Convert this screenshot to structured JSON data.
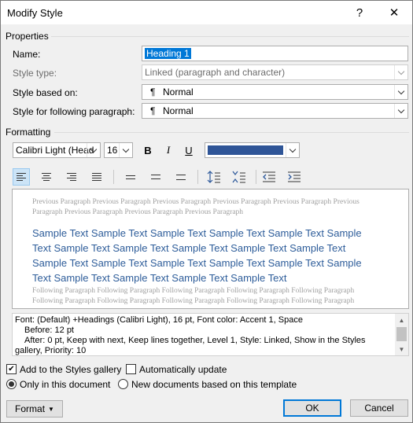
{
  "window": {
    "title": "Modify Style",
    "help_label": "?",
    "close_label": "✕"
  },
  "properties": {
    "section_label": "Properties",
    "name_label": "Name:",
    "name_value": "Heading 1",
    "style_type_label": "Style type:",
    "style_type_value": "Linked (paragraph and character)",
    "based_on_label": "Style based on:",
    "based_on_value": "Normal",
    "following_label": "Style for following paragraph:",
    "following_value": "Normal",
    "paragraph_glyph": "¶"
  },
  "formatting": {
    "section_label": "Formatting",
    "font_value": "Calibri Light (Head",
    "size_value": "16",
    "bold_label": "B",
    "italic_label": "I",
    "underline_label": "U",
    "font_color": "#2f5597"
  },
  "preview": {
    "previous_text": "Previous Paragraph Previous Paragraph Previous Paragraph Previous Paragraph Previous Paragraph Previous Paragraph Previous Paragraph Previous Paragraph Previous Paragraph",
    "sample_text": "Sample Text Sample Text Sample Text Sample Text Sample Text Sample Text Sample Text Sample Text Sample Text Sample Text Sample Text Sample Text Sample Text Sample Text Sample Text Sample Text Sample Text Sample Text Sample Text Sample Text Sample Text",
    "following_text": "Following Paragraph Following Paragraph Following Paragraph Following Paragraph Following Paragraph Following Paragraph Following Paragraph Following Paragraph Following Paragraph Following Paragraph"
  },
  "description": {
    "line1": "Font: (Default) +Headings (Calibri Light), 16 pt, Font color: Accent 1, Space",
    "line2": "Before:  12 pt",
    "line3": "After:  0 pt, Keep with next, Keep lines together, Level 1, Style: Linked, Show in the Styles",
    "line4": "gallery, Priority: 10"
  },
  "options": {
    "add_to_gallery_label": "Add to the Styles gallery",
    "add_to_gallery_checked": true,
    "auto_update_label": "Automatically update",
    "auto_update_checked": false,
    "only_this_doc_label": "Only in this document",
    "new_docs_label": "New documents based on this template"
  },
  "buttons": {
    "format_label": "Format",
    "ok_label": "OK",
    "cancel_label": "Cancel"
  }
}
